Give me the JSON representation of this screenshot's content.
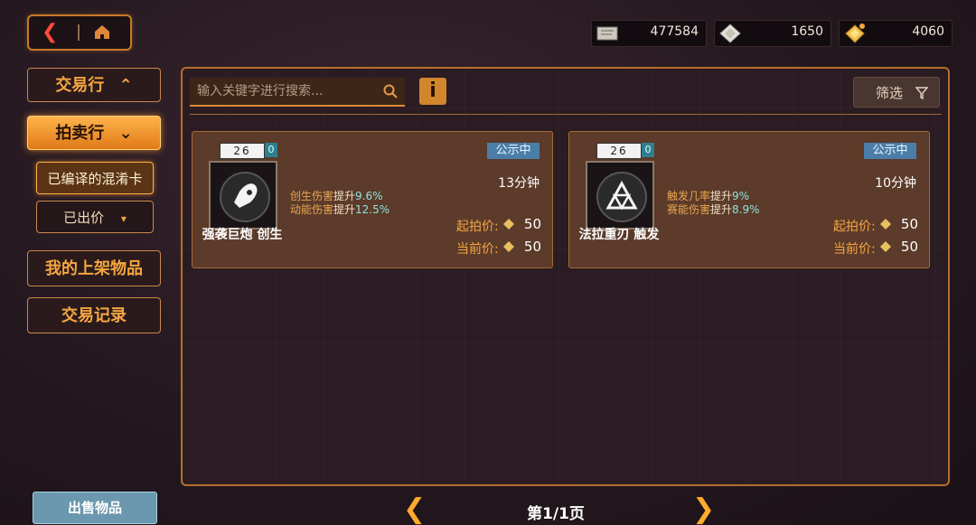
{
  "currency": [
    {
      "icon": "ticket-icon",
      "value": "477584"
    },
    {
      "icon": "silver-gem-icon",
      "value": "1650"
    },
    {
      "icon": "gold-gem-icon",
      "value": "4060"
    }
  ],
  "sidebar": {
    "trade_label": "交易行",
    "auction_label": "拍卖行",
    "sub_encoded": "已编译的混淆卡",
    "sub_bid": "已出价",
    "my_listings": "我的上架物品",
    "trade_history": "交易记录"
  },
  "search": {
    "placeholder": "输入关键字进行搜索..."
  },
  "info_label": "i",
  "filter_label": "筛选",
  "cards": [
    {
      "level": "26",
      "level_badge": "0",
      "name": "强袭巨炮 创生",
      "stat1_label": "创生伤害",
      "stat1_prefix": "提升",
      "stat1_value": "9.6%",
      "stat2_label": "动能伤害",
      "stat2_prefix": "提升",
      "stat2_value": "12.5%",
      "status": "公示中",
      "time": "13分钟",
      "start_label": "起拍价:",
      "start_value": "50",
      "current_label": "当前价:",
      "current_value": "50",
      "icon": "rocket-icon"
    },
    {
      "level": "26",
      "level_badge": "0",
      "name": "法拉重刃 触发",
      "stat1_label": "触发几率",
      "stat1_prefix": "提升",
      "stat1_value": "9%",
      "stat2_label": "赛能伤害",
      "stat2_prefix": "提升",
      "stat2_value": "8.9%",
      "status": "公示中",
      "time": "10分钟",
      "start_label": "起拍价:",
      "start_value": "50",
      "current_label": "当前价:",
      "current_value": "50",
      "icon": "triangle-emblem-icon"
    }
  ],
  "footer": {
    "sell_label": "出售物品",
    "page_label": "第1/1页"
  },
  "colors": {
    "accent": "#f5a640",
    "panel_border": "#b56d2c",
    "status_badge": "#4a7ea8"
  }
}
